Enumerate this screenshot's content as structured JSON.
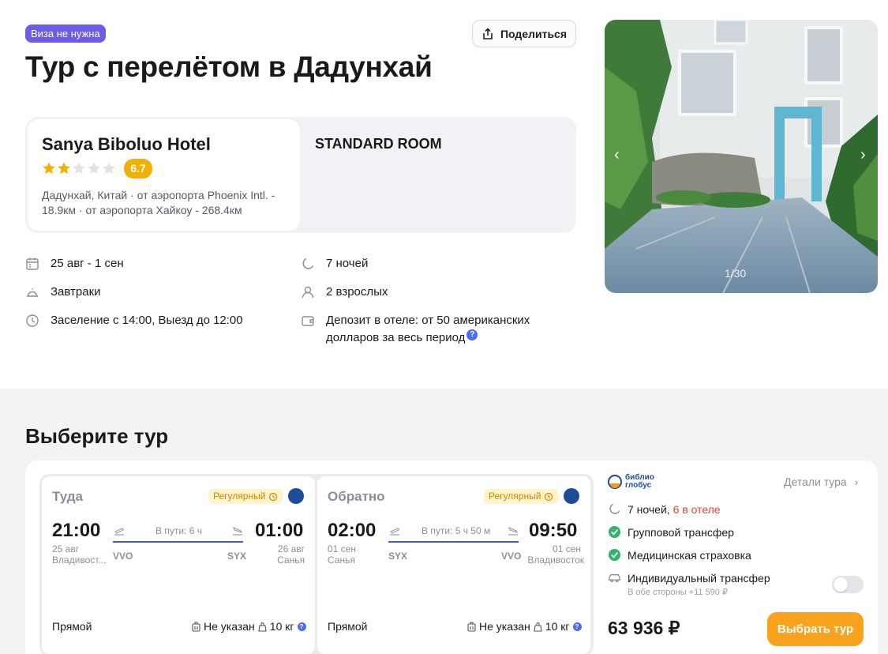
{
  "header": {
    "visa_badge": "Виза не нужна",
    "share_label": "Поделиться",
    "title": "Тур с перелётом в Дадунхай"
  },
  "hotel": {
    "name": "Sanya Biboluo Hotel",
    "stars": 2,
    "stars_max": 5,
    "rating": "6.7",
    "location": "Дадунхай, Китай · от аэропорта Phoenix Intl. - 18.9км · от аэропорта Хайкоу - 268.4км",
    "room": "STANDARD ROOM"
  },
  "details": {
    "dates": "25 авг - 1 сен",
    "nights": "7 ночей",
    "meals": "Завтраки",
    "guests": "2 взрослых",
    "checkin": "Заселение с 14:00, Выезд до 12:00",
    "deposit": "Депозит в отеле: от 50 американских долларов за весь период"
  },
  "gallery": {
    "counter": "1/30"
  },
  "tour_section": {
    "title": "Выберите тур",
    "outbound": {
      "direction": "Туда",
      "badge": "Регулярный",
      "dep_time": "21:00",
      "dep_date": "25 авг",
      "dep_city": "Владивост...",
      "dep_code": "VVO",
      "duration": "В пути: 6 ч",
      "arr_time": "01:00",
      "arr_date": "26 авг",
      "arr_city": "Санья",
      "arr_code": "SYX",
      "type": "Прямой",
      "baggage_hand": "Не указан",
      "baggage_weight": "10 кг"
    },
    "return": {
      "direction": "Обратно",
      "badge": "Регулярный",
      "dep_time": "02:00",
      "dep_date": "01 сен",
      "dep_city": "Санья",
      "dep_code": "SYX",
      "duration": "В пути: 5 ч 50 м",
      "arr_time": "09:50",
      "arr_date": "01 сен",
      "arr_city": "Владивосток",
      "arr_code": "VVO",
      "type": "Прямой",
      "baggage_hand": "Не указан",
      "baggage_weight": "10 кг"
    },
    "operator": {
      "logo_line1": "библио",
      "logo_line2": "глобус",
      "details_link": "Детали тура"
    },
    "features": {
      "nights": "7 ночей,",
      "in_hotel": "6 в отеле",
      "group_transfer": "Групповой трансфер",
      "insurance": "Медицинская страховка",
      "individual_transfer": "Индивидуальный трансфер",
      "individual_transfer_note": "В обе стороны +11 590 ₽"
    },
    "price": "63 936 ₽",
    "choose_label": "Выбрать тур"
  },
  "colors": {
    "accent": "#6d5ce8",
    "rating": "#f0b100",
    "cta": "#f9a21b",
    "highlight_red": "#e0442e",
    "link_blue": "#4a57d6"
  }
}
